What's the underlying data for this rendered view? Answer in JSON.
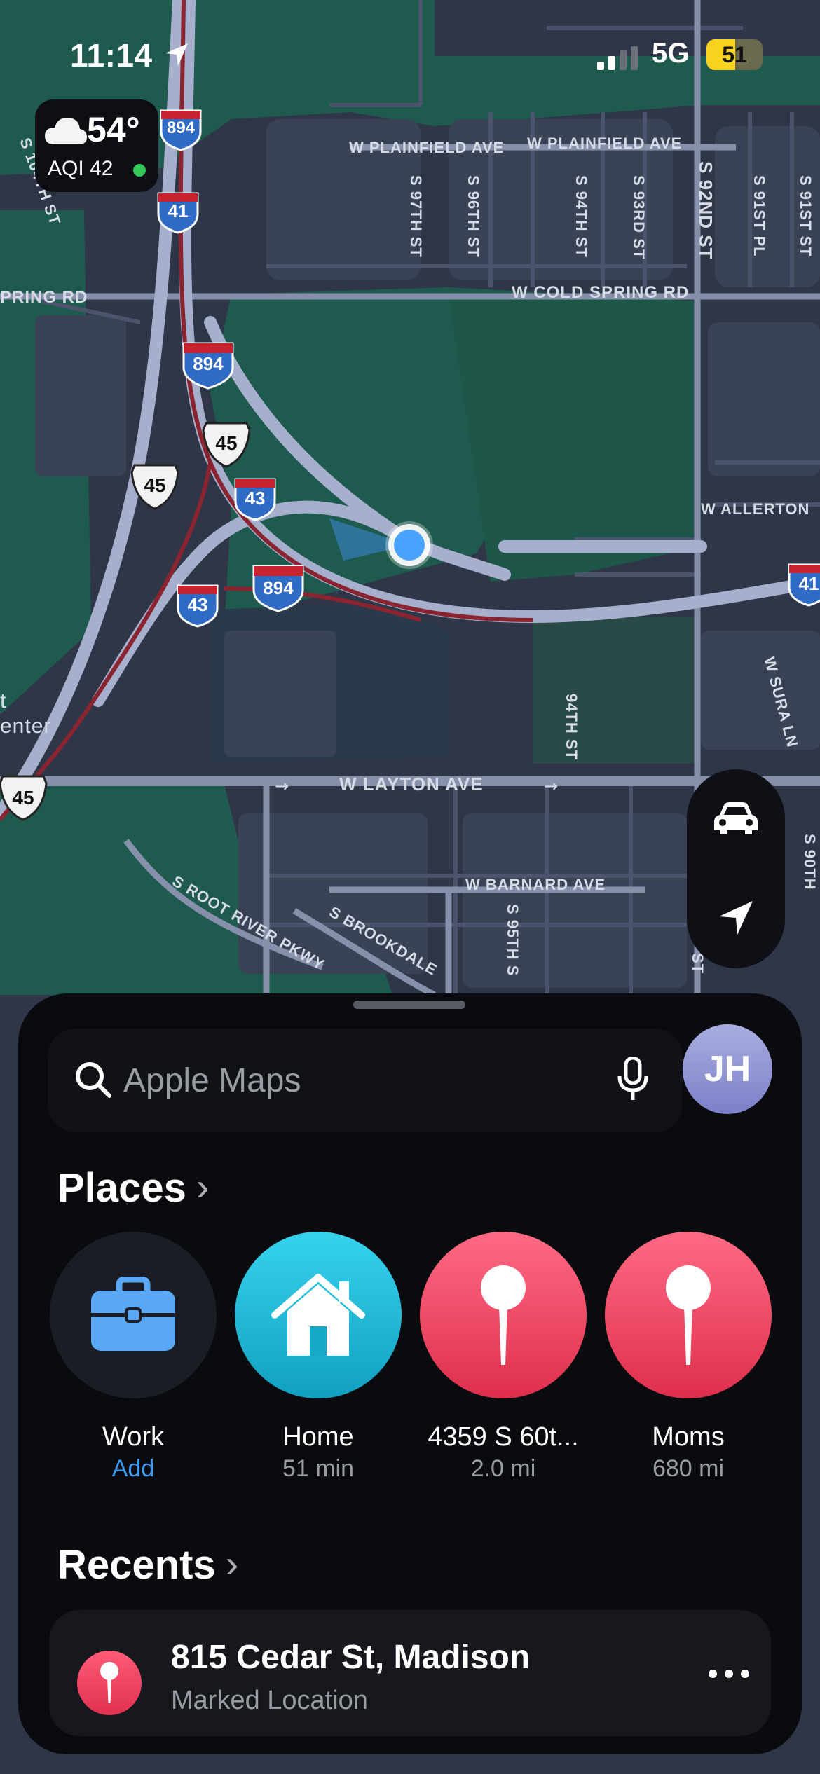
{
  "status_bar": {
    "time": "11:14",
    "network": "5G",
    "battery": "51",
    "battery_level": 0.51
  },
  "weather": {
    "temperature": "54°",
    "aqi": "AQI 42"
  },
  "map": {
    "street_labels": {
      "w_plainfield_1": "W PLAINFIELD AVE",
      "w_plainfield_2": "W PLAINFIELD AVE",
      "w_cold_spring": "W COLD SPRING RD",
      "spring_rd": "PRING RD",
      "w_layton": "W LAYTON AVE",
      "w_barnard": "W BARNARD AVE",
      "w_allerton": "W ALLERTON",
      "w_sura_ln": "W SURA LN",
      "s_root_river": "S ROOT RIVER PKWY",
      "s_brookdale": "S BROOKDALE",
      "s_97th": "S 97TH ST",
      "s_96th": "S 96TH ST",
      "s_94th": "S 94TH ST",
      "s_93rd": "S 93RD ST",
      "s_92nd": "S 92ND ST",
      "s_91st_pl": "S 91ST PL",
      "s_91st": "S 91ST ST",
      "s_94th_lower": "94TH ST",
      "s_95th": "S 95TH S",
      "s_104th": "S 104TH ST",
      "st_fragment": "ST",
      "s_90th": "S 90TH",
      "poi_t": "t",
      "poi_center": "enter"
    },
    "shields": {
      "i894_top": "894",
      "i41_top": "41",
      "i894_mid": "894",
      "us45_a": "45",
      "us45_b": "45",
      "i43_top": "43",
      "i894_low": "894",
      "i43_low": "43",
      "i41_right": "41",
      "us45_left": "45"
    }
  },
  "search": {
    "placeholder": "Apple Maps"
  },
  "profile": {
    "initials": "JH"
  },
  "places": {
    "title": "Places",
    "items": [
      {
        "name": "Work",
        "sub": "Add",
        "icon": "briefcase-icon"
      },
      {
        "name": "Home",
        "sub": "51 min",
        "icon": "house-icon"
      },
      {
        "name": "4359 S 60t...",
        "sub": "2.0 mi",
        "icon": "pin-icon"
      },
      {
        "name": "Moms",
        "sub": "680 mi",
        "icon": "pin-icon"
      }
    ]
  },
  "recents": {
    "title": "Recents",
    "items": [
      {
        "title": "815 Cedar St, Madison",
        "subtitle": "Marked Location",
        "icon": "pin-icon"
      }
    ]
  },
  "colors": {
    "map_background": "#2f3648",
    "park_green": "#1f5a4e",
    "road": "#9aa4c2",
    "interstate": "#8a2430",
    "location_dot": "#4aa3ff",
    "link_blue": "#3a9bf4",
    "home_teal": "#1fb7d6",
    "pin_red": "#e63b5a",
    "battery_yellow": "#f7d21e"
  }
}
